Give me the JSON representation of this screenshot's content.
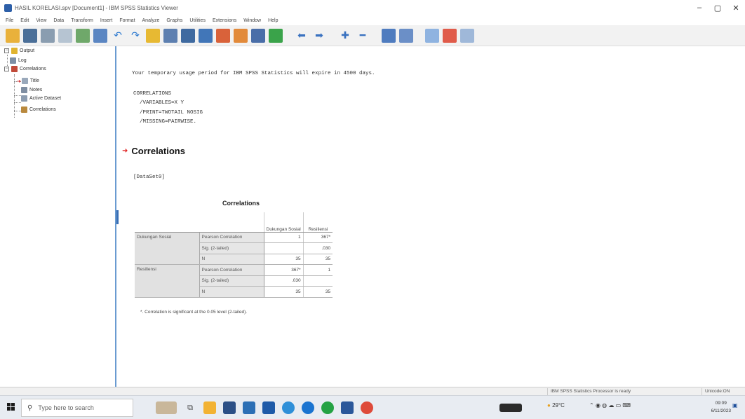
{
  "window": {
    "title": "HASIL KORELASI.spv [Document1] - IBM SPSS Statistics Viewer",
    "minimize": "–",
    "maximize": "▢",
    "close": "✕"
  },
  "menu": [
    "File",
    "Edit",
    "View",
    "Data",
    "Transform",
    "Insert",
    "Format",
    "Analyze",
    "Graphs",
    "Utilities",
    "Extensions",
    "Window",
    "Help"
  ],
  "toolbar_icons": [
    "open-folder-icon",
    "save-icon",
    "print-icon",
    "print-preview-icon",
    "export-icon",
    "recall-dialog-icon",
    "undo-icon",
    "redo-icon",
    "goto-case-icon",
    "goto-variable-icon",
    "variables-icon",
    "split-file-icon",
    "weight-cases-icon",
    "select-cases-icon",
    "value-labels-icon",
    "designate-window-icon",
    "go-back-icon",
    "go-forward-icon",
    "expand-icon",
    "collapse-icon",
    "show-icon",
    "hide-icon",
    "insert-heading-icon",
    "insert-title-icon",
    "insert-text-icon"
  ],
  "outline": {
    "root": "Output",
    "log": "Log",
    "correlations": "Correlations",
    "title": "Title",
    "notes": "Notes",
    "active_dataset": "Active Dataset",
    "correlations_table": "Correlations"
  },
  "output": {
    "license_notice": "Your temporary usage period for IBM SPSS Statistics will expire in 4500 days.",
    "syntax": [
      "CORRELATIONS",
      "  /VARIABLES=X Y",
      "  /PRINT=TWOTAIL NOSIG",
      "  /MISSING=PAIRWISE."
    ],
    "heading": "Correlations",
    "dataset": "[DataSet0]"
  },
  "table": {
    "title": "Correlations",
    "col_headers": [
      "Dukungan Sosial",
      "Resiliensi"
    ],
    "rows": [
      {
        "variable": "Dukungan Sosial",
        "stats": [
          {
            "label": "Pearson Correlation",
            "values": [
              "1",
              "367*"
            ]
          },
          {
            "label": "Sig. (2-tailed)",
            "values": [
              "",
              ".030"
            ]
          },
          {
            "label": "N",
            "values": [
              "35",
              "35"
            ]
          }
        ]
      },
      {
        "variable": "Resiliensi",
        "stats": [
          {
            "label": "Pearson Correlation",
            "values": [
              "367*",
              "1"
            ]
          },
          {
            "label": "Sig. (2-tailed)",
            "values": [
              ".030",
              ""
            ]
          },
          {
            "label": "N",
            "values": [
              "35",
              "35"
            ]
          }
        ]
      }
    ],
    "footnote": "*. Correlation is significant at the 0.05 level (2-tailed)."
  },
  "status": {
    "processor": "IBM SPSS Statistics Processor is ready",
    "encoding": "Unicode:ON"
  },
  "taskbar": {
    "search_placeholder": "Type here to search",
    "weather": "29°C",
    "time": "09:09",
    "date": "6/11/2023"
  },
  "colors": {
    "accent": "#6a9bd1",
    "heading_arrow": "#e02020",
    "table_label_bg": "#e1e1e1"
  }
}
